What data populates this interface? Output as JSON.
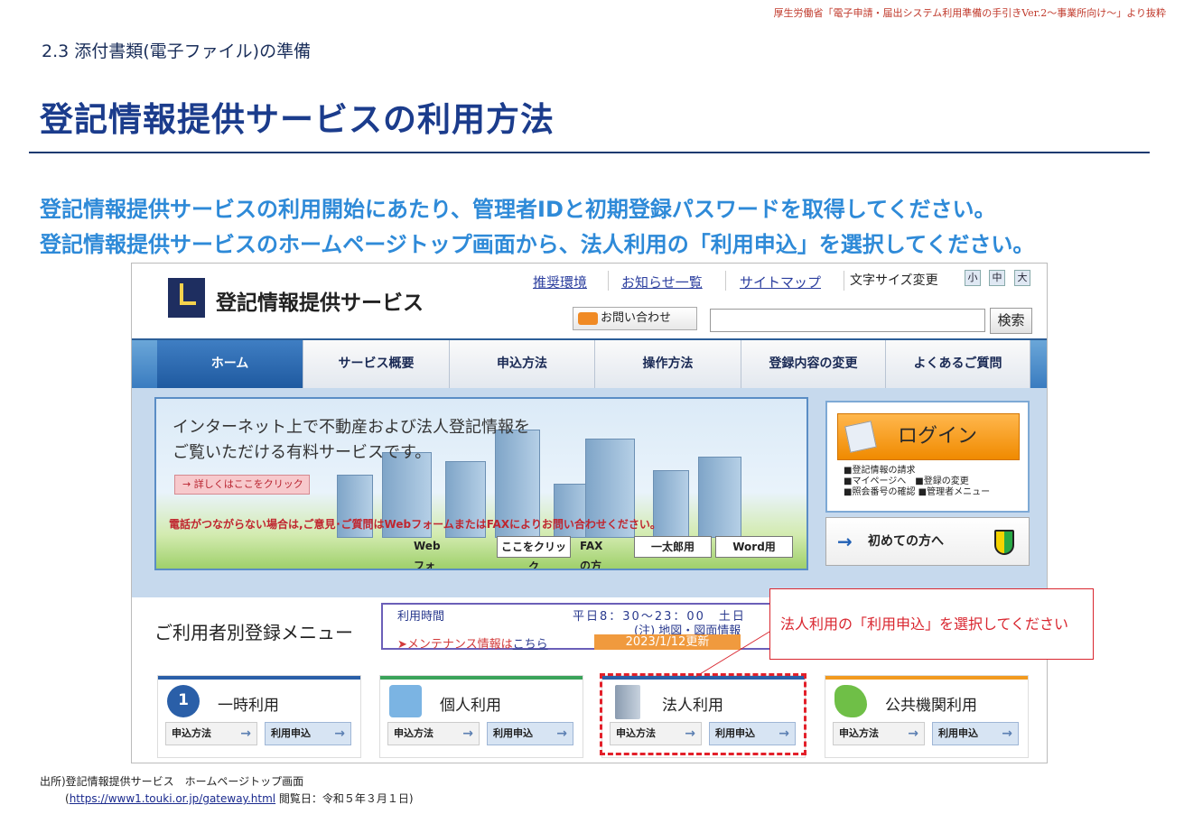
{
  "source_note": "厚生労働省「電子申請・届出システム利用準備の手引きVer.2～事業所向け～」より抜粋",
  "section": "2.3 添付書類(電子ファイル)の準備",
  "title": "登記情報提供サービスの利用方法",
  "lead": [
    "登記情報提供サービスの利用開始にあたり、管理者IDと初期登録パスワードを取得してください。",
    "登記情報提供サービスのホームページトップ画面から、法人利用の「利用申込」を選択してください。"
  ],
  "site": {
    "name": "登記情報提供サービス",
    "top_links": [
      "推奨環境",
      "お知らせ一覧",
      "サイトマップ"
    ],
    "font_size_label": "文字サイズ変更",
    "font_sizes": [
      "小",
      "中",
      "大"
    ],
    "contact": "お問い合わせ",
    "search_label": "検索",
    "nav": [
      "ホーム",
      "サービス概要",
      "申込方法",
      "操作方法",
      "登録内容の変更",
      "よくあるご質問"
    ],
    "hero": {
      "line1": "インターネット上で不動産および法人登記情報を",
      "line2": "ご覧いただける有料サービスです。",
      "detail": "→ 詳しくはここをクリック",
      "notice": "電話がつながらない場合は,ご意見･ご質問はWebフォームまたはFAXによりお問い合わせください。",
      "webform_label": "Webフォームは",
      "webform_btn": "ここをクリック",
      "fax_label": "FAXの方",
      "ichitaro": "一太郎用",
      "word": "Word用"
    },
    "login": {
      "label": "ログイン",
      "links": [
        "■登記情報の請求",
        "■マイページへ　■登録の変更",
        "■照会番号の確認 ■管理者メニュー"
      ]
    },
    "first_time": "初めての方へ",
    "registration_menu": "ご利用者別登録メニュー",
    "info": {
      "hours_label": "利用時間",
      "hours": "平日8：30～23：00　土日",
      "note": "(注) 地図・図面情報",
      "maint": "➤メンテナンス情報は",
      "maint_link": "こちら",
      "updated": "2023/1/12更新"
    },
    "cards": [
      {
        "title": "一時利用",
        "method": "申込方法",
        "apply": "利用申込",
        "color": "#2a5fa8",
        "icon": "time-icon",
        "icon_text": "1"
      },
      {
        "title": "個人利用",
        "method": "申込方法",
        "apply": "利用申込",
        "color": "#3aa35a",
        "icon": "house-icon"
      },
      {
        "title": "法人利用",
        "method": "申込方法",
        "apply": "利用申込",
        "color": "#2a5fa8",
        "icon": "building-icon"
      },
      {
        "title": "公共機関利用",
        "method": "申込方法",
        "apply": "利用申込",
        "color": "#f29a1f",
        "icon": "map-person-icon"
      }
    ]
  },
  "callout": "法人利用の「利用申込」を選択してください",
  "footer": {
    "source": "出所)登記情報提供サービス　ホームページトップ画面",
    "url": "https://www1.touki.or.jp/gateway.html",
    "url_prefix": "(",
    "viewed": "閲覧日：令和５年３月１日)"
  }
}
